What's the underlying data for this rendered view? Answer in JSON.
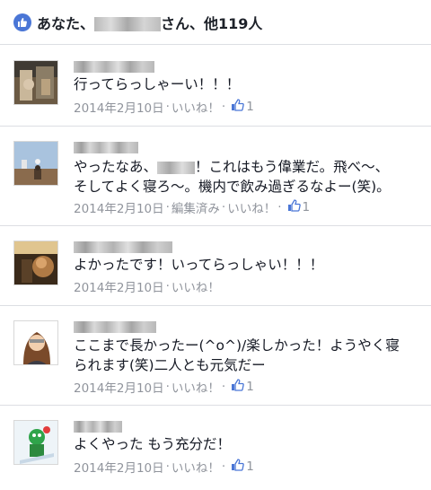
{
  "likes": {
    "prefix": "あなた、",
    "suffix": "さん、他119人"
  },
  "comments": [
    {
      "lines": [
        "行ってらっしゃーい！！！"
      ],
      "date": "2014年2月10日",
      "like_label": "いいね！",
      "like_count": "1"
    },
    {
      "lines_a_pre": "やったなあ、",
      "lines_a_post": "！これはもう偉業だ。飛べ〜、",
      "line2": "そしてよく寝ろ〜。機内で飲み過ぎるなよー(笑)。",
      "date": "2014年2月10日",
      "edited": "編集済み",
      "like_label": "いいね！",
      "like_count": "1"
    },
    {
      "lines": [
        "よかったです！いってらっしゃい！！！"
      ],
      "date": "2014年2月10日",
      "like_label": "いいね！"
    },
    {
      "lines": [
        "ここまで長かったー(^o^)/楽しかった！ようやく寝",
        "られます(笑)二人とも元気だー"
      ],
      "date": "2014年2月10日",
      "like_label": "いいね！",
      "like_count": "1"
    },
    {
      "lines": [
        "よくやった もう充分だ！"
      ],
      "date": "2014年2月10日",
      "like_label": "いいね！",
      "like_count": "1"
    }
  ],
  "icons": {
    "likes_bar": "thumbs-up-icon",
    "like_count": "thumbs-up-icon"
  },
  "colors": {
    "accent": "#4a76d6",
    "meta_text": "#90949c",
    "divider": "#dcdee3"
  }
}
